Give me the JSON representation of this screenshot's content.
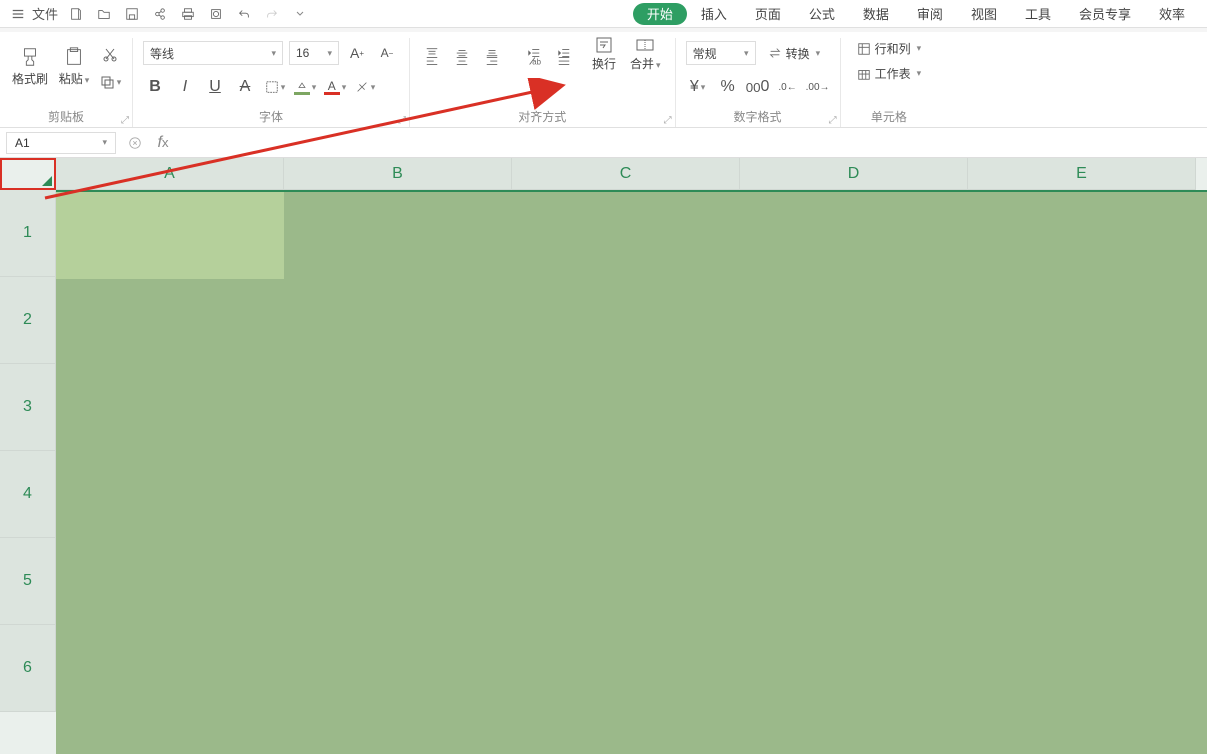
{
  "menu": {
    "file": "文件",
    "tabs": [
      {
        "label": "开始",
        "active": true
      },
      {
        "label": "插入",
        "active": false
      },
      {
        "label": "页面",
        "active": false
      },
      {
        "label": "公式",
        "active": false
      },
      {
        "label": "数据",
        "active": false
      },
      {
        "label": "审阅",
        "active": false
      },
      {
        "label": "视图",
        "active": false
      },
      {
        "label": "工具",
        "active": false
      },
      {
        "label": "会员专享",
        "active": false
      },
      {
        "label": "效率",
        "active": false
      }
    ]
  },
  "ribbon": {
    "clipboard": {
      "format_painter": "格式刷",
      "paste": "粘贴",
      "label": "剪贴板"
    },
    "font": {
      "name": "等线",
      "size": "16",
      "label": "字体"
    },
    "alignment": {
      "wrap": "换行",
      "merge": "合并",
      "label": "对齐方式"
    },
    "number": {
      "format": "常规",
      "convert": "转换",
      "label": "数字格式"
    },
    "cell": {
      "rowcol": "行和列",
      "sheet": "工作表",
      "label": "单元格"
    }
  },
  "formula_bar": {
    "name_box": "A1"
  },
  "grid": {
    "columns": [
      "A",
      "B",
      "C",
      "D",
      "E"
    ],
    "rows": [
      "1",
      "2",
      "3",
      "4",
      "5",
      "6"
    ]
  },
  "colors": {
    "fill": "#9bb98a",
    "font_color": "#d93025",
    "accent": "#2e8b57"
  }
}
